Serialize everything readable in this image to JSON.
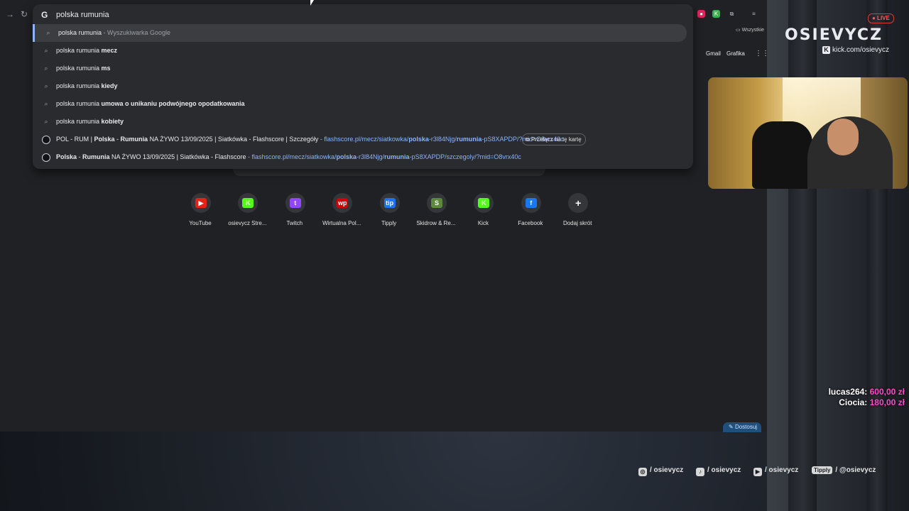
{
  "omnibox": {
    "query": "polska rumunia",
    "suggestions": [
      {
        "prefix": "polska rumunia",
        "bold": "",
        "suffix": " - Wyszukiwarka Google",
        "type": "search"
      },
      {
        "prefix": "polska rumunia ",
        "bold": "mecz",
        "suffix": "",
        "type": "search"
      },
      {
        "prefix": "polska rumunia ",
        "bold": "ms",
        "suffix": "",
        "type": "search"
      },
      {
        "prefix": "polska rumunia ",
        "bold": "kiedy",
        "suffix": "",
        "type": "search"
      },
      {
        "prefix": "polska rumunia ",
        "bold": "umowa o unikaniu podwójnego opodatkowania",
        "suffix": "",
        "type": "search"
      },
      {
        "prefix": "polska rumunia ",
        "bold": "kobiety",
        "suffix": "",
        "type": "search"
      }
    ],
    "url_suggestions": [
      {
        "title_a": "POL - RUM | ",
        "title_b": "Polska",
        "title_c": " - ",
        "title_d": "Rumunia",
        "title_e": " NA ŻYWO 13/09/2025 | Siatkówka - Flashscore | Szczegóły",
        "url_a": " - flashscore.pl/mecz/siatkowka/",
        "url_b": "polska",
        "url_c": "-r3l84Njg/",
        "url_d": "rumunia",
        "url_e": "-pS8XAPDP/?mid=O8vrx40c",
        "switch_label": "Przełącz na tę kartę"
      },
      {
        "title_a": "",
        "title_b": "Polska",
        "title_c": " - ",
        "title_d": "Rumunia",
        "title_e": " NA ŻYWO 13/09/2025 | Siatkówka - Flashscore",
        "url_a": " - flashscore.pl/mecz/siatkowka/",
        "url_b": "polska",
        "url_c": "-r3l84Njg/",
        "url_d": "rumunia",
        "url_e": "-pS8XAPDP/szczegoly/?mid=O8vrx40c"
      }
    ]
  },
  "bookmarks": {
    "folder_label": "Wszystkie"
  },
  "top_links": {
    "gmail": "Gmail",
    "images": "Grafika"
  },
  "shortcuts": [
    {
      "label": "YouTube",
      "glyph": "▶",
      "color": "#e62117"
    },
    {
      "label": "osievycz Stre...",
      "glyph": "K",
      "color": "#53fc18"
    },
    {
      "label": "Twitch",
      "glyph": "t",
      "color": "#9146ff"
    },
    {
      "label": "Wirtualna Pol...",
      "glyph": "wp",
      "color": "#d40000"
    },
    {
      "label": "Tipply",
      "glyph": "tip",
      "color": "#1d73f2"
    },
    {
      "label": "Skidrow & Re...",
      "glyph": "S",
      "color": "#5c8a3c"
    },
    {
      "label": "Kick",
      "glyph": "K",
      "color": "#53fc18"
    },
    {
      "label": "Facebook",
      "glyph": "f",
      "color": "#1877f2"
    },
    {
      "label": "Dodaj skrót",
      "glyph": "+",
      "color": "#35363a"
    }
  ],
  "customize_label": "Dostosuj",
  "overlay": {
    "live": "● LIVE",
    "logo": "OSIEVYCZ",
    "kick_url": "kick.com/osievycz",
    "donations": [
      {
        "name": "lucas264:",
        "amount": "600,00 zł"
      },
      {
        "name": "Ciocia:",
        "amount": "180,00 zł"
      }
    ],
    "socials": [
      {
        "icon": "instagram-icon",
        "text": "/ osievycz"
      },
      {
        "icon": "tiktok-icon",
        "text": "/ osievycz"
      },
      {
        "icon": "youtube-icon",
        "text": "/ osievycz"
      },
      {
        "icon": "tipply-icon",
        "badge": "Tipply",
        "text": "/ @osievycz"
      }
    ]
  }
}
